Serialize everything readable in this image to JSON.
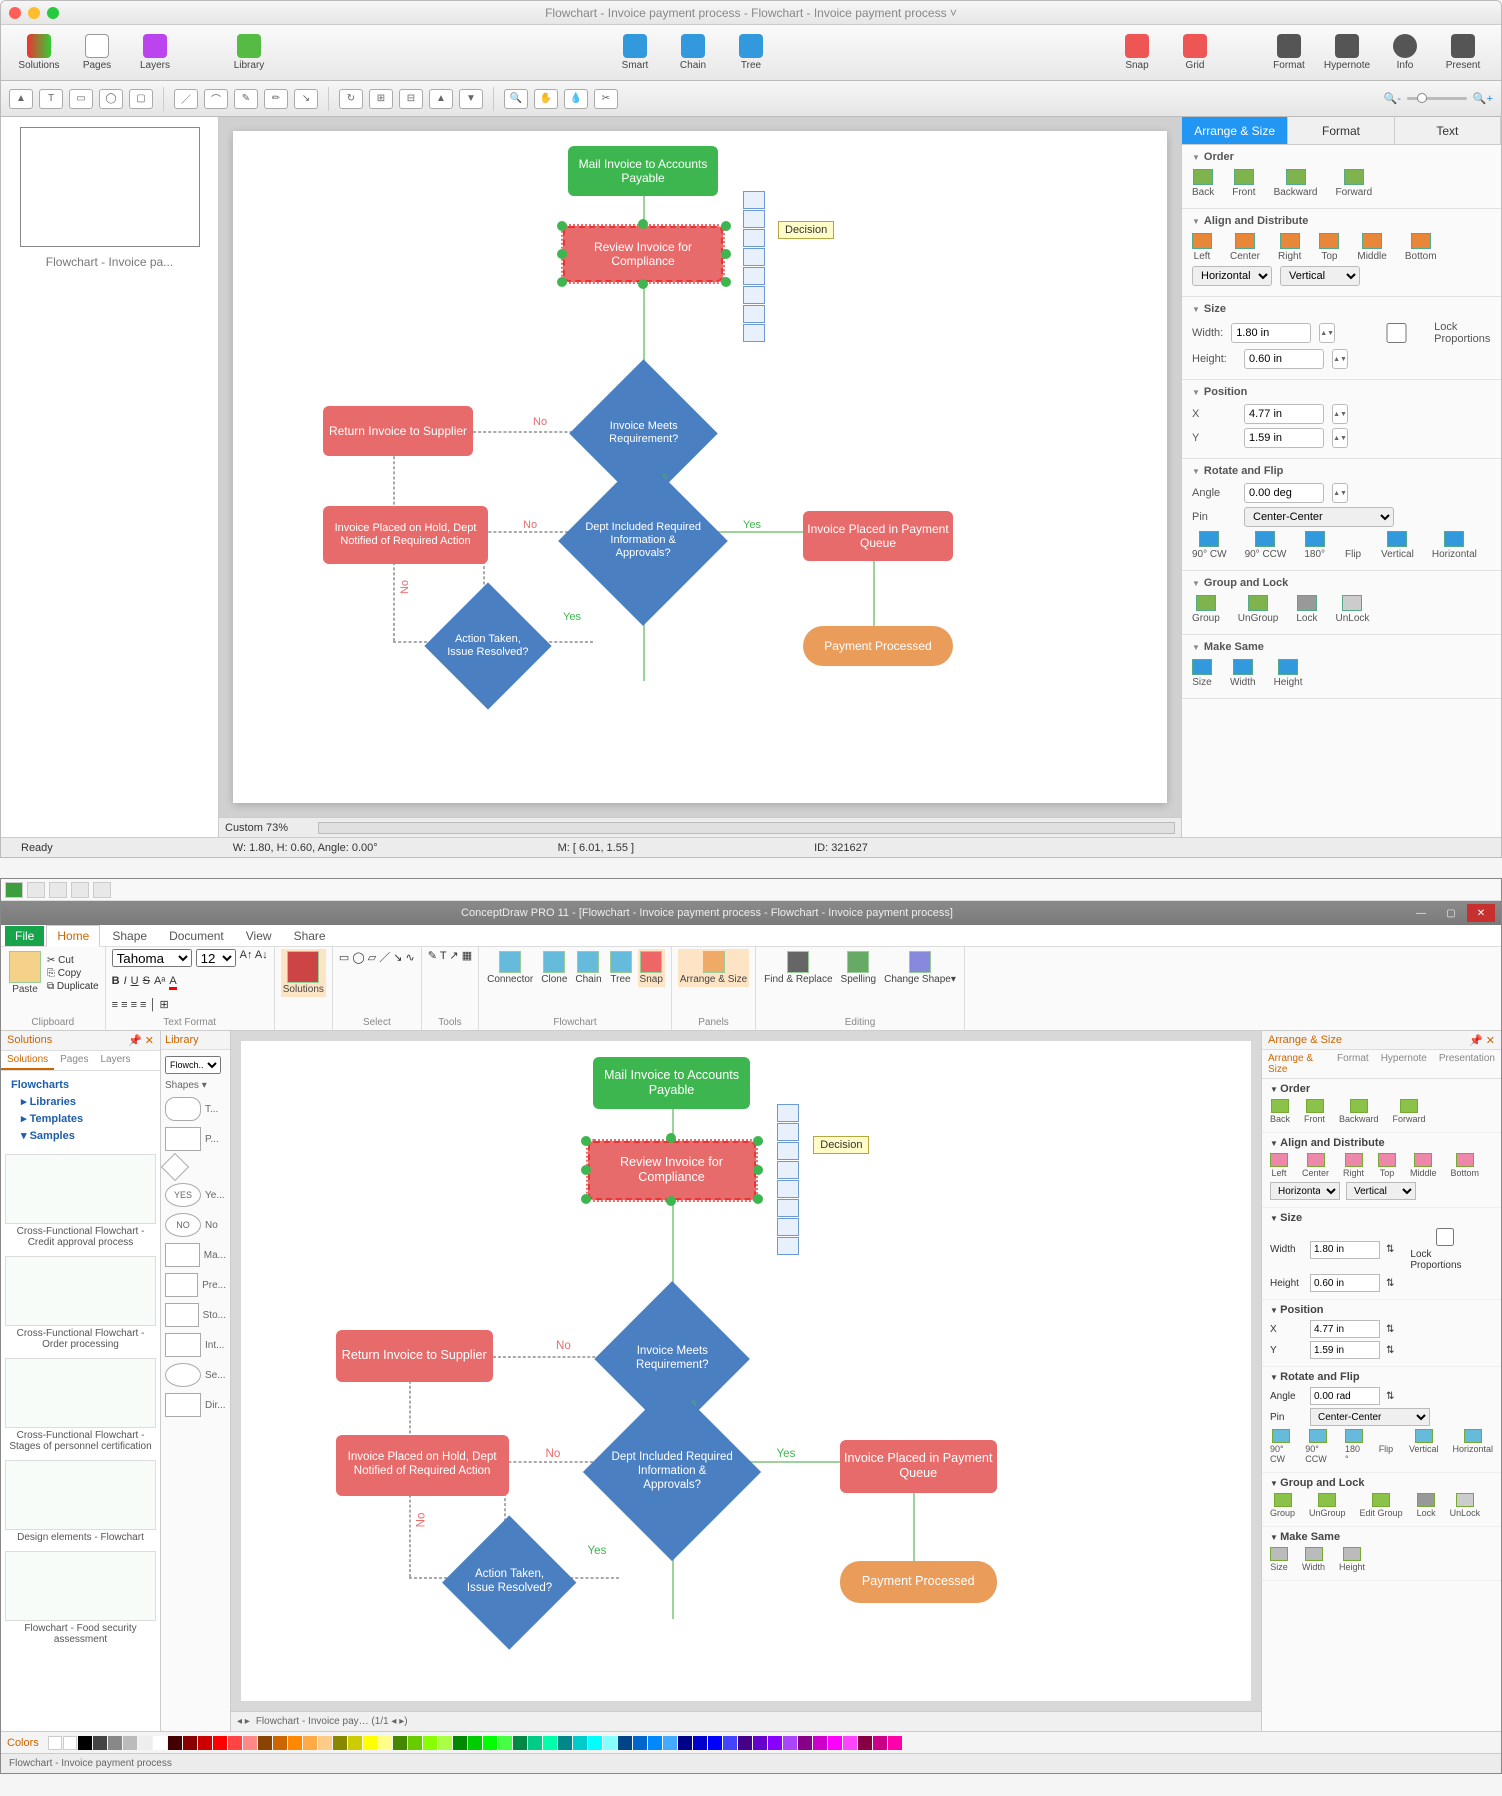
{
  "mac": {
    "title": "Flowchart - Invoice payment process - Flowchart - Invoice payment process ˅",
    "toolbar": {
      "solutions": "Solutions",
      "pages": "Pages",
      "layers": "Layers",
      "library": "Library",
      "smart": "Smart",
      "chain": "Chain",
      "tree": "Tree",
      "snap": "Snap",
      "grid": "Grid",
      "format": "Format",
      "hypernote": "Hypernote",
      "info": "Info",
      "present": "Present"
    },
    "thumb_label": "Flowchart - Invoice pa...",
    "zoom": "Custom 73%",
    "statusL": "Ready",
    "statusW": "W: 1.80,  H: 0.60,  Angle: 0.00°",
    "statusM": "M: [ 6.01, 1.55 ]",
    "statusID": "ID: 321627",
    "tooltip": "Decision",
    "rpanel": {
      "tabs": {
        "arrange": "Arrange & Size",
        "format": "Format",
        "text": "Text"
      },
      "order": {
        "h": "Order",
        "back": "Back",
        "front": "Front",
        "backward": "Backward",
        "forward": "Forward"
      },
      "align": {
        "h": "Align and Distribute",
        "left": "Left",
        "center": "Center",
        "right": "Right",
        "top": "Top",
        "middle": "Middle",
        "bottom": "Bottom",
        "horiz": "Horizontal",
        "vert": "Vertical"
      },
      "size": {
        "h": "Size",
        "wlbl": "Width:",
        "w": "1.80 in",
        "hlbl": "Height:",
        "hv": "0.60 in",
        "lock": "Lock Proportions"
      },
      "pos": {
        "h": "Position",
        "x": "X",
        "xv": "4.77 in",
        "y": "Y",
        "yv": "1.59 in"
      },
      "rot": {
        "h": "Rotate and Flip",
        "alabel": "Angle",
        "a": "0.00 deg",
        "plabel": "Pin",
        "p": "Center-Center",
        "cw": "90° CW",
        "ccw": "90° CCW",
        "r180": "180°",
        "flip": "Flip",
        "v": "Vertical",
        "hz": "Horizontal"
      },
      "grp": {
        "h": "Group and Lock",
        "group": "Group",
        "ungroup": "UnGroup",
        "lock": "Lock",
        "unlock": "UnLock"
      },
      "same": {
        "h": "Make Same",
        "size": "Size",
        "width": "Width",
        "height": "Height"
      }
    }
  },
  "flow": {
    "n1": "Mail Invoice to Accounts Payable",
    "n2": "Review Invoice for Compliance",
    "n3": "Invoice Meets Requirement?",
    "n4": "Return Invoice to Supplier",
    "n5": "Dept Included Required Information & Approvals?",
    "n6": "Invoice Placed on Hold, Dept Notified of Required Action",
    "n7": "Invoice Placed in Payment Queue",
    "n8": "Action Taken, Issue Resolved?",
    "n9": "Payment Processed",
    "yes": "Yes",
    "no": "No"
  },
  "win": {
    "title": "ConceptDraw PRO 11 - [Flowchart - Invoice payment process - Flowchart - Invoice payment process]",
    "ribtabs": {
      "file": "File",
      "home": "Home",
      "shape": "Shape",
      "document": "Document",
      "view": "View",
      "share": "Share"
    },
    "clip": {
      "cut": "Cut",
      "copy": "Copy",
      "dup": "Duplicate",
      "paste": "Paste",
      "lbl": "Clipboard"
    },
    "font": {
      "name": "Tahoma",
      "size": "12",
      "lbl": "Text Format"
    },
    "grp": {
      "solutions": "Solutions",
      "select": "Select",
      "tools": "Tools",
      "connector": "Connector",
      "clone": "Clone",
      "chain": "Chain",
      "tree": "Tree",
      "snap": "Snap",
      "arrange": "Arrange & Size",
      "find": "Find & Replace",
      "spell": "Spelling",
      "change": "Change Shape▾",
      "flowchart": "Flowchart",
      "panels": "Panels",
      "editing": "Editing"
    },
    "left": {
      "solutions": "Solutions",
      "library": "Library",
      "tabs": {
        "sol": "Solutions",
        "pages": "Pages",
        "layers": "Layers"
      },
      "tree": {
        "flowcharts": "Flowcharts",
        "libraries": "Libraries",
        "templates": "Templates",
        "samples": "Samples"
      },
      "lib_sel": "Flowch...",
      "shapes": "Shapes ▾",
      "s1": "Cross-Functional Flowchart - Credit approval process",
      "s2": "Cross-Functional Flowchart - Order processing",
      "s3": "Cross-Functional Flowchart - Stages of personnel certification",
      "s4": "Design elements - Flowchart",
      "s5": "Flowchart - Food security assessment",
      "sh": {
        "t": "T...",
        "p": "P...",
        "d": "",
        "yes": "YES",
        "no": "NO",
        "ma": "Ma...",
        "pre": "Pre...",
        "sto": "Sto...",
        "int": "Int...",
        "seq": "Se...",
        "dir": "Dir..."
      }
    },
    "canvas_tab": "Flowchart - Invoice pay…  (1/1  ◂ ▸)",
    "right": {
      "hdr": "Arrange & Size",
      "tabs": {
        "as": "Arrange & Size",
        "format": "Format",
        "hyper": "Hypernote",
        "pres": "Presentation"
      },
      "order": {
        "h": "Order",
        "back": "Back",
        "front": "Front",
        "backward": "Backward",
        "forward": "Forward"
      },
      "align": {
        "h": "Align and Distribute",
        "left": "Left",
        "center": "Center",
        "right": "Right",
        "top": "Top",
        "middle": "Middle",
        "bottom": "Bottom",
        "horiz": "Horizontal",
        "vert": "Vertical"
      },
      "size": {
        "h": "Size",
        "wlbl": "Width",
        "w": "1.80 in",
        "hlbl": "Height",
        "hv": "0.60 in",
        "lock": "Lock Proportions"
      },
      "pos": {
        "h": "Position",
        "x": "X",
        "xv": "4.77 in",
        "y": "Y",
        "yv": "1.59 in"
      },
      "rot": {
        "h": "Rotate and Flip",
        "alabel": "Angle",
        "a": "0.00 rad",
        "plabel": "Pin",
        "p": "Center-Center",
        "cw": "90° CW",
        "ccw": "90° CCW",
        "r180": "180 °",
        "flip": "Flip",
        "v": "Vertical",
        "hz": "Horizontal"
      },
      "grp": {
        "h": "Group and Lock",
        "group": "Group",
        "ungroup": "UnGroup",
        "edit": "Edit Group",
        "lock": "Lock",
        "unlock": "UnLock"
      },
      "same": {
        "h": "Make Same",
        "size": "Size",
        "width": "Width",
        "height": "Height"
      }
    },
    "colors": "Colors",
    "status": "Flowchart - Invoice payment process"
  }
}
